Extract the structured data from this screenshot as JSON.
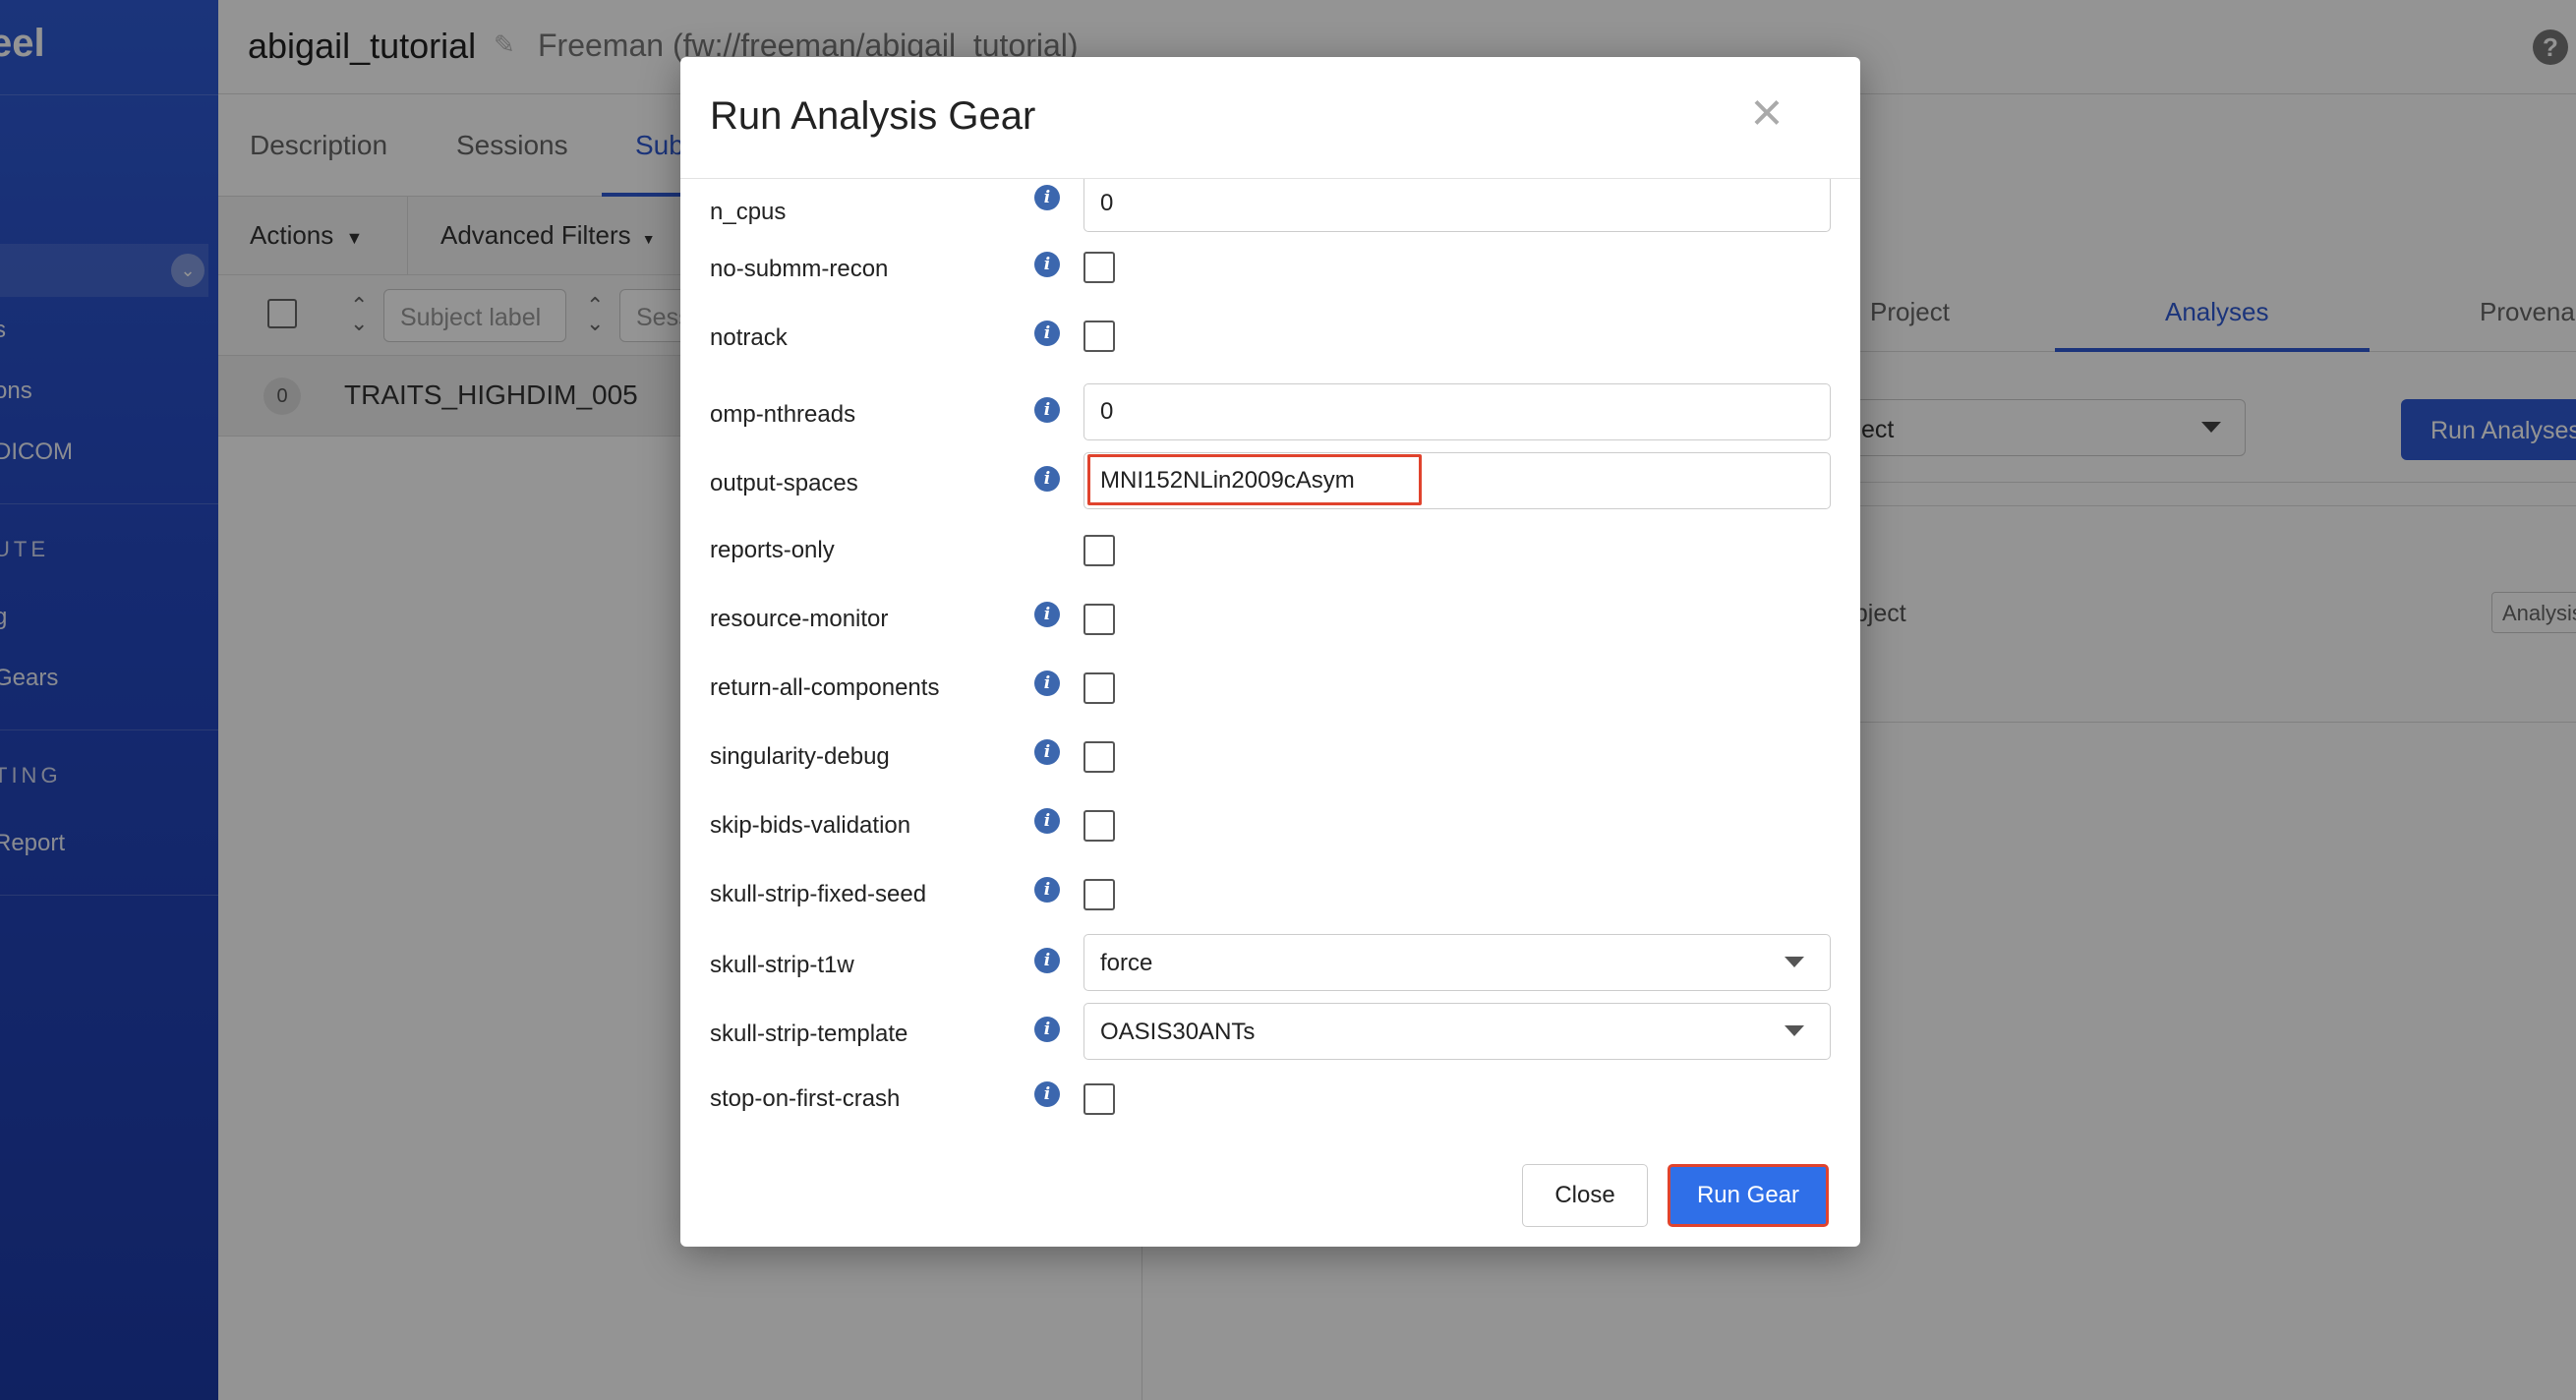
{
  "sidebar": {
    "brand": "eel",
    "items": [
      {
        "label": "s"
      },
      {
        "label": "ons"
      },
      {
        "label": "DICOM"
      },
      {
        "label": "g"
      },
      {
        "label": " Gears"
      },
      {
        "label": "Report"
      }
    ],
    "sections": [
      "UTE",
      "TING"
    ]
  },
  "header": {
    "project_title": "abigail_tutorial",
    "project_path": "Freeman (fw://freeman/abigail_tutorial)",
    "help_label": "?"
  },
  "tabs": [
    "Description",
    "Sessions",
    "Sub"
  ],
  "toolbar": {
    "actions_label": "Actions",
    "advanced_filters_label": "Advanced Filters"
  },
  "filters": {
    "subject_label_placeholder": "Subject label",
    "session_placeholder": "Sess"
  },
  "subject_row": {
    "count": "0",
    "label": "TRAITS_HIGHDIM_005"
  },
  "right_panel": {
    "tabs": [
      "Project",
      "Analyses",
      "Provenar"
    ],
    "select_value": "ect",
    "run_button_label": "Run Analyses",
    "row_label": "ubject",
    "row_badge": "Analysis"
  },
  "modal": {
    "title": "Run Analysis Gear",
    "close_symbol": "×",
    "info_glyph": "i",
    "fields": [
      {
        "label": "n_cpus",
        "type": "text",
        "value": "0",
        "info": true
      },
      {
        "label": "no-submm-recon",
        "type": "checkbox",
        "info": true
      },
      {
        "label": "notrack",
        "type": "checkbox",
        "info": true
      },
      {
        "label": "omp-nthreads",
        "type": "text",
        "value": "0",
        "info": true
      },
      {
        "label": "output-spaces",
        "type": "text",
        "value": "MNI152NLin2009cAsym",
        "info": true,
        "highlighted": true
      },
      {
        "label": "reports-only",
        "type": "checkbox",
        "info": false
      },
      {
        "label": "resource-monitor",
        "type": "checkbox",
        "info": true
      },
      {
        "label": "return-all-components",
        "type": "checkbox",
        "info": true
      },
      {
        "label": "singularity-debug",
        "type": "checkbox",
        "info": true
      },
      {
        "label": "skip-bids-validation",
        "type": "checkbox",
        "info": true
      },
      {
        "label": "skull-strip-fixed-seed",
        "type": "checkbox",
        "info": true
      },
      {
        "label": "skull-strip-t1w",
        "type": "select",
        "value": "force",
        "info": true
      },
      {
        "label": "skull-strip-template",
        "type": "select",
        "value": "OASIS30ANTs",
        "info": true
      },
      {
        "label": "stop-on-first-crash",
        "type": "checkbox",
        "info": true
      }
    ],
    "close_button_label": "Close",
    "run_button_label": "Run Gear"
  },
  "colors": {
    "brand_blue": "#2f5bd4",
    "run_gear_blue": "#2f6fe8",
    "highlight_red": "#e0432d",
    "info_icon": "#3c67ae"
  }
}
